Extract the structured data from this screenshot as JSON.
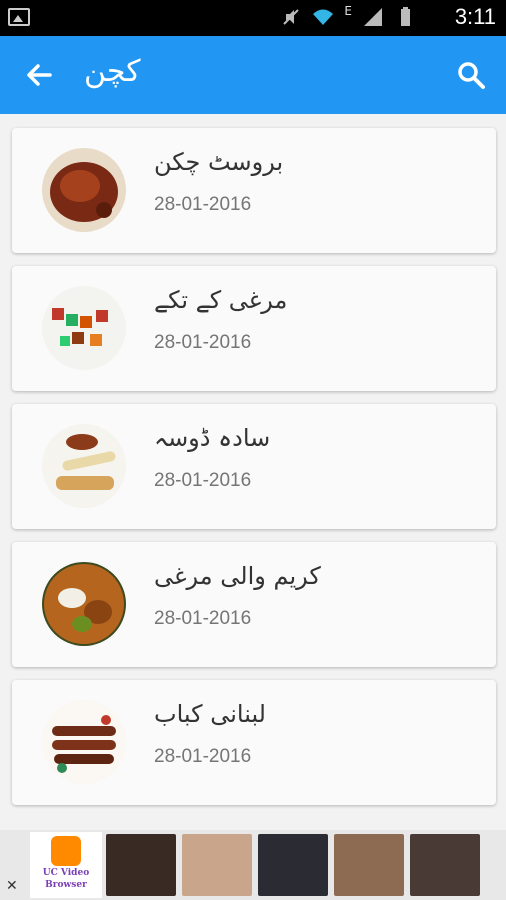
{
  "status_bar": {
    "network_letter": "E",
    "time": "3:11"
  },
  "app_bar": {
    "title": "کچن"
  },
  "recipes": [
    {
      "name": "بروسٹ چکن",
      "date": "28-01-2016"
    },
    {
      "name": "مرغی کے تکے",
      "date": "28-01-2016"
    },
    {
      "name": "سادہ ڈوسہ",
      "date": "28-01-2016"
    },
    {
      "name": "کریم والی مرغی",
      "date": "28-01-2016"
    },
    {
      "name": "لبنانی کباب",
      "date": "28-01-2016"
    }
  ],
  "ad": {
    "close_glyph": "✕",
    "brand_line1": "UC Video",
    "brand_line2": "Browser"
  },
  "colors": {
    "app_bar": "#2196f3",
    "background": "#f2f2f2",
    "card": "#fafafa"
  }
}
